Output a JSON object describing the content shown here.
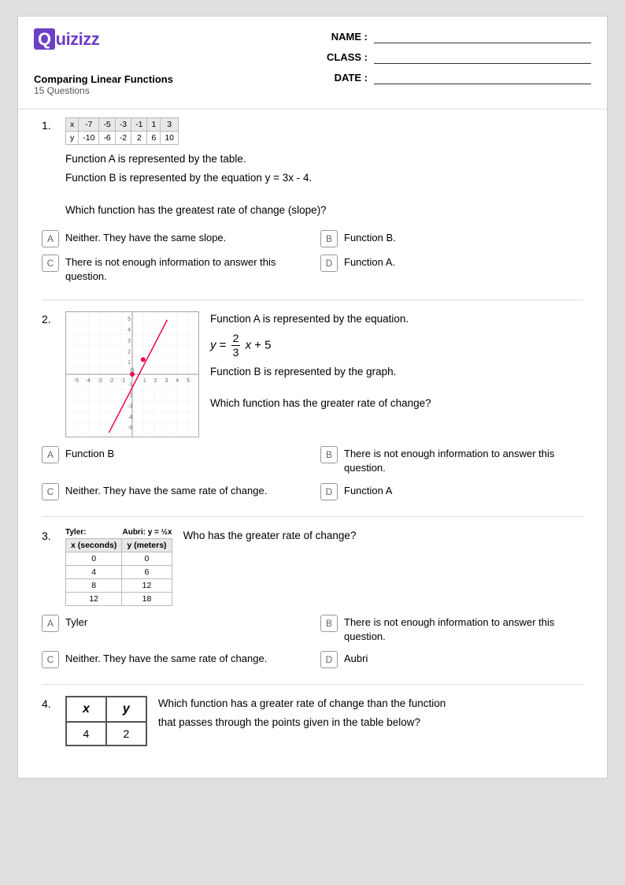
{
  "header": {
    "logo_text": "Quizizz",
    "quiz_title": "Comparing Linear Functions",
    "quiz_subtitle": "15 Questions",
    "fields": [
      {
        "label": "NAME :",
        "id": "name"
      },
      {
        "label": "CLASS :",
        "id": "class"
      },
      {
        "label": "DATE :",
        "id": "date"
      }
    ]
  },
  "questions": [
    {
      "number": "1.",
      "text_lines": [
        "Function A is represented by the table.",
        "Function B is represented by the equation y = 3x - 4.",
        "",
        "Which function has the greatest rate of change (slope)?"
      ],
      "table_q1": {
        "headers": [
          "x",
          "-7",
          "-5",
          "-3",
          "-1",
          "1",
          "3"
        ],
        "row": [
          "y",
          "-10",
          "-6",
          "-2",
          "2",
          "6",
          "10"
        ]
      },
      "options": [
        {
          "letter": "A",
          "text": "Neither. They have the same slope."
        },
        {
          "letter": "B",
          "text": "Function B."
        },
        {
          "letter": "C",
          "text": "There is not enough information to answer this question."
        },
        {
          "letter": "D",
          "text": "Function A."
        }
      ]
    },
    {
      "number": "2.",
      "text_lines": [
        "Function A is represented by the equation.",
        "",
        "Function B is represented by the graph.",
        "",
        "Which function has the greater rate of change?"
      ],
      "equation": "y = (2/3)x + 5",
      "options": [
        {
          "letter": "A",
          "text": "Function B"
        },
        {
          "letter": "B",
          "text": "There is not enough information to answer this question."
        },
        {
          "letter": "C",
          "text": "Neither. They have the same rate of change."
        },
        {
          "letter": "D",
          "text": "Function A"
        }
      ]
    },
    {
      "number": "3.",
      "text": "Who has the greater rate of change?",
      "tyler_label": "Tyler:",
      "aubri_label": "Aubri: y = ½x",
      "table_q3": {
        "headers": [
          "x (seconds)",
          "y (meters)"
        ],
        "rows": [
          [
            "0",
            "0"
          ],
          [
            "4",
            "6"
          ],
          [
            "8",
            "12"
          ],
          [
            "12",
            "18"
          ]
        ]
      },
      "options": [
        {
          "letter": "A",
          "text": "Tyler"
        },
        {
          "letter": "B",
          "text": "There is not enough information to answer this question."
        },
        {
          "letter": "C",
          "text": "Neither. They have the same rate of change."
        },
        {
          "letter": "D",
          "text": "Aubri"
        }
      ]
    },
    {
      "number": "4.",
      "text_lines": [
        "Which function has a greater rate of change than the function",
        "that passes through the points given in the table below?"
      ],
      "table_q4": {
        "col_x": "x",
        "col_y": "y",
        "rows": [
          [
            "4",
            "2"
          ]
        ]
      }
    }
  ]
}
